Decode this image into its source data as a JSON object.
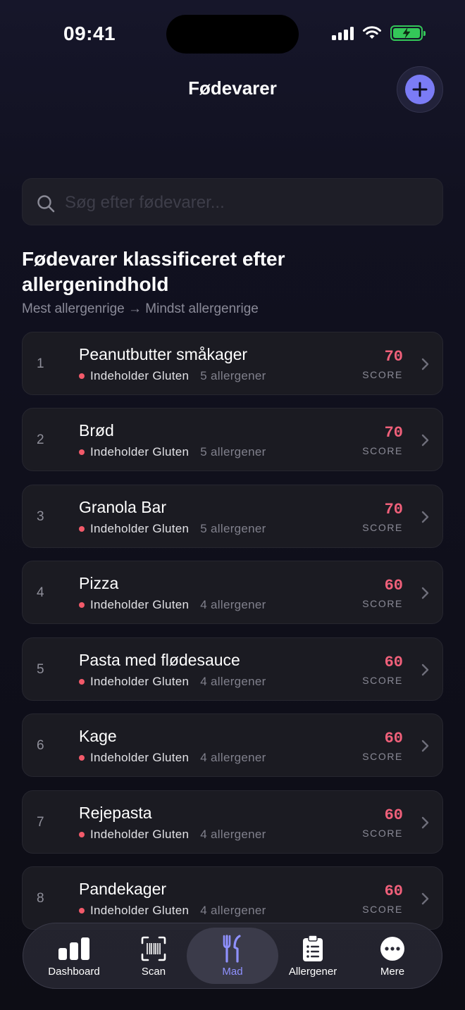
{
  "status_bar": {
    "time": "09:41"
  },
  "header": {
    "title": "Fødevarer"
  },
  "search": {
    "placeholder": "Søg efter fødevarer..."
  },
  "section": {
    "title": "Fødevarer klassificeret efter allergenindhold",
    "subtitle": "Mest allergenrige → Mindst allergenrige"
  },
  "foods": [
    {
      "rank": "1",
      "name": "Peanutbutter småkager",
      "tag": "Indeholder Gluten",
      "allergens": "5 allergener",
      "score": "70",
      "score_label": "SCORE"
    },
    {
      "rank": "2",
      "name": "Brød",
      "tag": "Indeholder Gluten",
      "allergens": "5 allergener",
      "score": "70",
      "score_label": "SCORE"
    },
    {
      "rank": "3",
      "name": "Granola Bar",
      "tag": "Indeholder Gluten",
      "allergens": "5 allergener",
      "score": "70",
      "score_label": "SCORE"
    },
    {
      "rank": "4",
      "name": "Pizza",
      "tag": "Indeholder Gluten",
      "allergens": "4 allergener",
      "score": "60",
      "score_label": "SCORE"
    },
    {
      "rank": "5",
      "name": "Pasta med flødesauce",
      "tag": "Indeholder Gluten",
      "allergens": "4 allergener",
      "score": "60",
      "score_label": "SCORE"
    },
    {
      "rank": "6",
      "name": "Kage",
      "tag": "Indeholder Gluten",
      "allergens": "4 allergener",
      "score": "60",
      "score_label": "SCORE"
    },
    {
      "rank": "7",
      "name": "Rejepasta",
      "tag": "Indeholder Gluten",
      "allergens": "4 allergener",
      "score": "60",
      "score_label": "SCORE"
    },
    {
      "rank": "8",
      "name": "Pandekager",
      "tag": "Indeholder Gluten",
      "allergens": "4 allergener",
      "score": "60",
      "score_label": "SCORE"
    }
  ],
  "tabbar": {
    "items": [
      {
        "label": "Dashboard",
        "icon": "bar-chart-icon"
      },
      {
        "label": "Scan",
        "icon": "barcode-scan-icon"
      },
      {
        "label": "Mad",
        "icon": "fork-knife-icon",
        "active": true
      },
      {
        "label": "Allergener",
        "icon": "clipboard-list-icon"
      },
      {
        "label": "Mere",
        "icon": "more-dots-icon"
      }
    ]
  },
  "colors": {
    "accent": "#7b7cf6",
    "score": "#f0607a",
    "gluten_dot": "#f25a6a",
    "battery": "#34c759"
  }
}
